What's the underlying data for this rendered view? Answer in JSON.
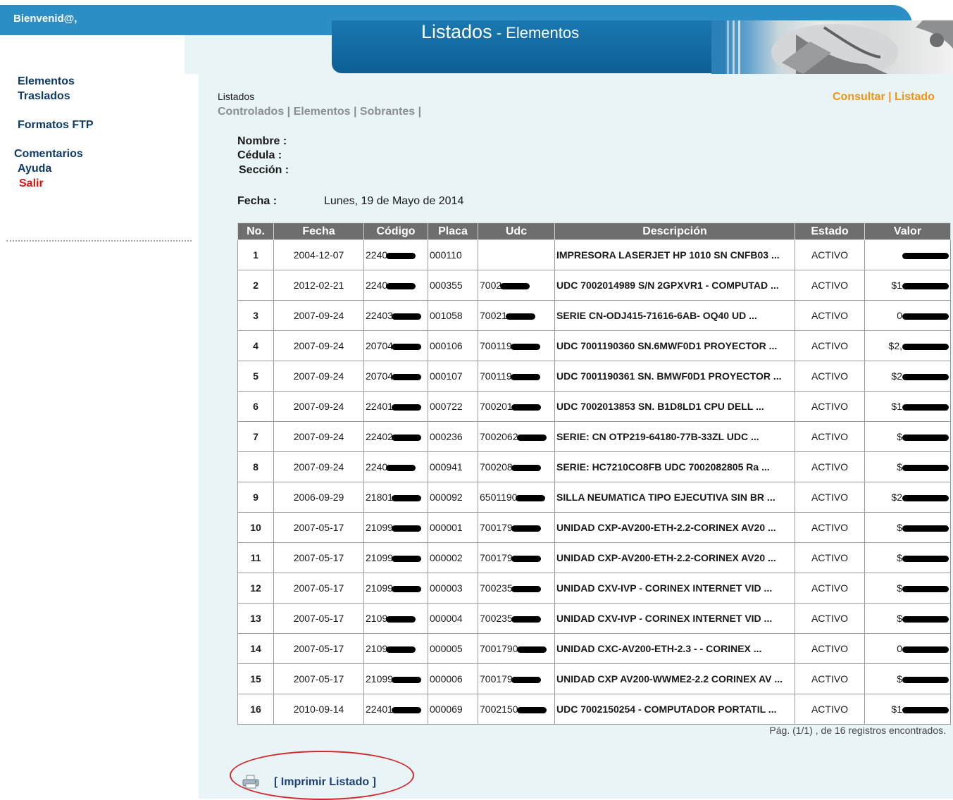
{
  "header": {
    "welcome": "Bienvenid@,",
    "title_main": "Listados",
    "title_sep": " - ",
    "title_sub": "Elementos"
  },
  "sidebar": {
    "items": [
      "Elementos",
      "Traslados",
      "Formatos FTP",
      "Comentarios",
      "Ayuda",
      "Salir"
    ]
  },
  "breadcrumb": {
    "label": "Listados",
    "links": [
      "Controlados",
      "Elementos",
      "Sobrantes"
    ],
    "separator": " | "
  },
  "actions": {
    "consultar": "Consultar",
    "separator": " | ",
    "listado": "Listado"
  },
  "info": {
    "nombre_label": "Nombre :",
    "cedula_label": "Cédula :",
    "seccion_label": "Sección :",
    "fecha_label": "Fecha :",
    "fecha_value": "Lunes, 19 de Mayo de 2014"
  },
  "table": {
    "headers": [
      "No.",
      "Fecha",
      "Código",
      "Placa",
      "Udc",
      "Descripción",
      "Estado",
      "Valor"
    ],
    "rows": [
      {
        "no": "1",
        "fecha": "2004-12-07",
        "codigo": "2240",
        "placa": "000110",
        "udc": "",
        "desc": "IMPRESORA LASERJET HP 1010 SN CNFB03 ...",
        "estado": "ACTIVO",
        "valor": ""
      },
      {
        "no": "2",
        "fecha": "2012-02-21",
        "codigo": "2240",
        "placa": "000355",
        "udc": "7002",
        "desc": "UDC 7002014989 S/N 2GPXVR1 - COMPUTAD ...",
        "estado": "ACTIVO",
        "valor": "$1"
      },
      {
        "no": "3",
        "fecha": "2007-09-24",
        "codigo": "22403",
        "placa": "001058",
        "udc": "70021",
        "desc": "SERIE CN-ODJ415-71616-6AB- OQ40 UD ...",
        "estado": "ACTIVO",
        "valor": "0"
      },
      {
        "no": "4",
        "fecha": "2007-09-24",
        "codigo": "20704",
        "placa": "000106",
        "udc": "700119",
        "desc": "UDC 7001190360 SN.6MWF0D1 PROYECTOR ...",
        "estado": "ACTIVO",
        "valor": "$2,"
      },
      {
        "no": "5",
        "fecha": "2007-09-24",
        "codigo": "20704",
        "placa": "000107",
        "udc": "700119",
        "desc": "UDC 7001190361 SN. BMWF0D1 PROYECTOR ...",
        "estado": "ACTIVO",
        "valor": "$2"
      },
      {
        "no": "6",
        "fecha": "2007-09-24",
        "codigo": "22401",
        "placa": "000722",
        "udc": "700201",
        "desc": "UDC 7002013853 SN. B1D8LD1 CPU DELL ...",
        "estado": "ACTIVO",
        "valor": "$1"
      },
      {
        "no": "7",
        "fecha": "2007-09-24",
        "codigo": "22402",
        "placa": "000236",
        "udc": "7002062",
        "desc": "SERIE: CN OTP219-64180-77B-33ZL UDC ...",
        "estado": "ACTIVO",
        "valor": "$"
      },
      {
        "no": "8",
        "fecha": "2007-09-24",
        "codigo": "2240",
        "placa": "000941",
        "udc": "700208",
        "desc": "SERIE: HC7210CO8FB UDC 7002082805 Ra ...",
        "estado": "ACTIVO",
        "valor": "$"
      },
      {
        "no": "9",
        "fecha": "2006-09-29",
        "codigo": "21801",
        "placa": "000092",
        "udc": "6501190",
        "desc": "SILLA NEUMATICA TIPO EJECUTIVA SIN BR ...",
        "estado": "ACTIVO",
        "valor": "$2"
      },
      {
        "no": "10",
        "fecha": "2007-05-17",
        "codigo": "21099",
        "placa": "000001",
        "udc": "700179",
        "desc": "UNIDAD CXP-AV200-ETH-2.2-CORINEX AV20 ...",
        "estado": "ACTIVO",
        "valor": "$"
      },
      {
        "no": "11",
        "fecha": "2007-05-17",
        "codigo": "21099",
        "placa": "000002",
        "udc": "700179",
        "desc": "UNIDAD CXP-AV200-ETH-2.2-CORINEX AV20 ...",
        "estado": "ACTIVO",
        "valor": "$"
      },
      {
        "no": "12",
        "fecha": "2007-05-17",
        "codigo": "21099",
        "placa": "000003",
        "udc": "700235",
        "desc": "UNIDAD CXV-IVP - CORINEX INTERNET VID ...",
        "estado": "ACTIVO",
        "valor": "$"
      },
      {
        "no": "13",
        "fecha": "2007-05-17",
        "codigo": "2109",
        "placa": "000004",
        "udc": "700235",
        "desc": "UNIDAD CXV-IVP - CORINEX INTERNET VID ...",
        "estado": "ACTIVO",
        "valor": "$"
      },
      {
        "no": "14",
        "fecha": "2007-05-17",
        "codigo": "2109",
        "placa": "000005",
        "udc": "7001790",
        "desc": "UNIDAD CXC-AV200-ETH-2.3 - - CORINEX ...",
        "estado": "ACTIVO",
        "valor": "0"
      },
      {
        "no": "15",
        "fecha": "2007-05-17",
        "codigo": "21099",
        "placa": "000006",
        "udc": "700179",
        "desc": "UNIDAD CXP AV200-WWME2-2.2 CORINEX AV ...",
        "estado": "ACTIVO",
        "valor": "$"
      },
      {
        "no": "16",
        "fecha": "2010-09-14",
        "codigo": "22401",
        "placa": "000069",
        "udc": "7002150",
        "desc": "UDC 7002150254 - COMPUTADOR PORTATIL ...",
        "estado": "ACTIVO",
        "valor": "$1"
      }
    ]
  },
  "pager": "Pág. (1/1) , de 16 registros encontrados.",
  "print": {
    "label": "[ Imprimir Listado ]",
    "icon": "printer-icon"
  },
  "colors": {
    "header_blue": "#2d8ec6",
    "title_blue": "#0c5f95",
    "content_bg": "#e9f4f6",
    "nav_text": "#0d3c6a",
    "exit_red": "#e0120e",
    "action_orange": "#f29312",
    "table_header": "#6e6e6e",
    "row_number_blue": "#1f58a8",
    "annotation_red": "#d2282c"
  }
}
